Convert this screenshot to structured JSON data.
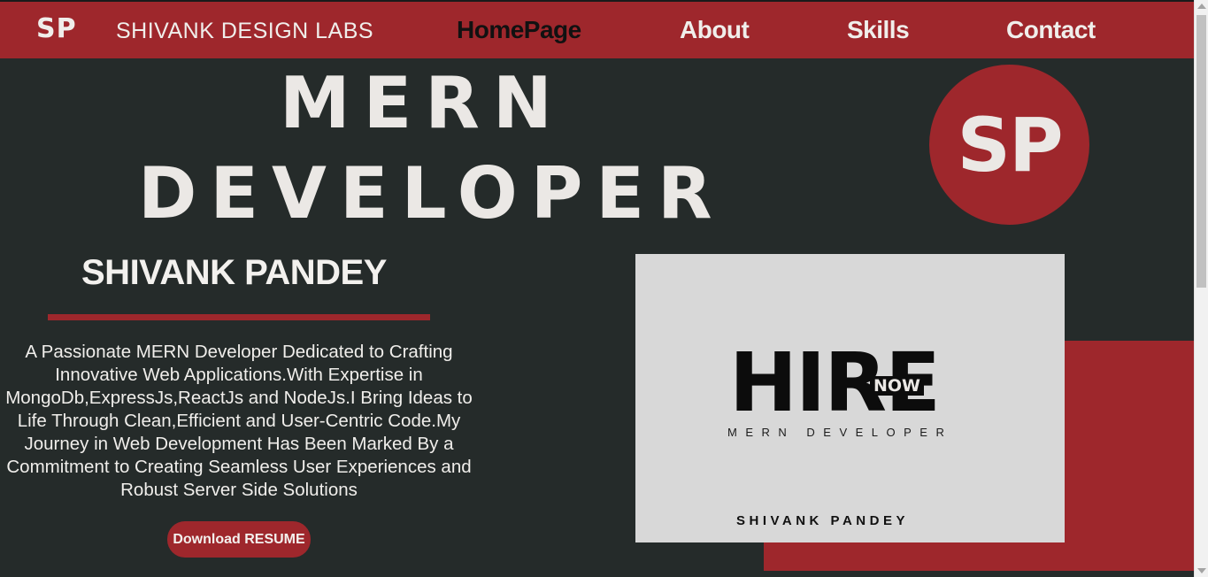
{
  "nav": {
    "logo": "SP",
    "brand": "SHIVANK DESIGN LABS",
    "links": [
      {
        "label": "HomePage",
        "active": true
      },
      {
        "label": "About",
        "active": false
      },
      {
        "label": "Skills",
        "active": false
      },
      {
        "label": "Contact",
        "active": false
      }
    ]
  },
  "hero": {
    "line1": "MERN",
    "line2": "DEVELOPER",
    "badge": "SP"
  },
  "profile": {
    "name": "SHIVANK PANDEY",
    "bio": "A Passionate MERN Developer Dedicated to Crafting Innovative Web Applications.With Expertise in MongoDb,ExpressJs,ReactJs and NodeJs.I Bring Ideas to Life Through Clean,Efficient and User-Centric Code.My Journey in Web Development Has Been Marked By a Commitment to Creating Seamless User Experiences and Robust Server Side Solutions",
    "resume_button": "Download RESUME"
  },
  "hire_card": {
    "word": "HIRE",
    "tag": "NOW",
    "role": "MERN DEVELOPER",
    "name": "SHIVANK PANDEY"
  },
  "colors": {
    "accent": "#9e272c",
    "background": "#252b2a",
    "text": "#ebe8e5"
  }
}
